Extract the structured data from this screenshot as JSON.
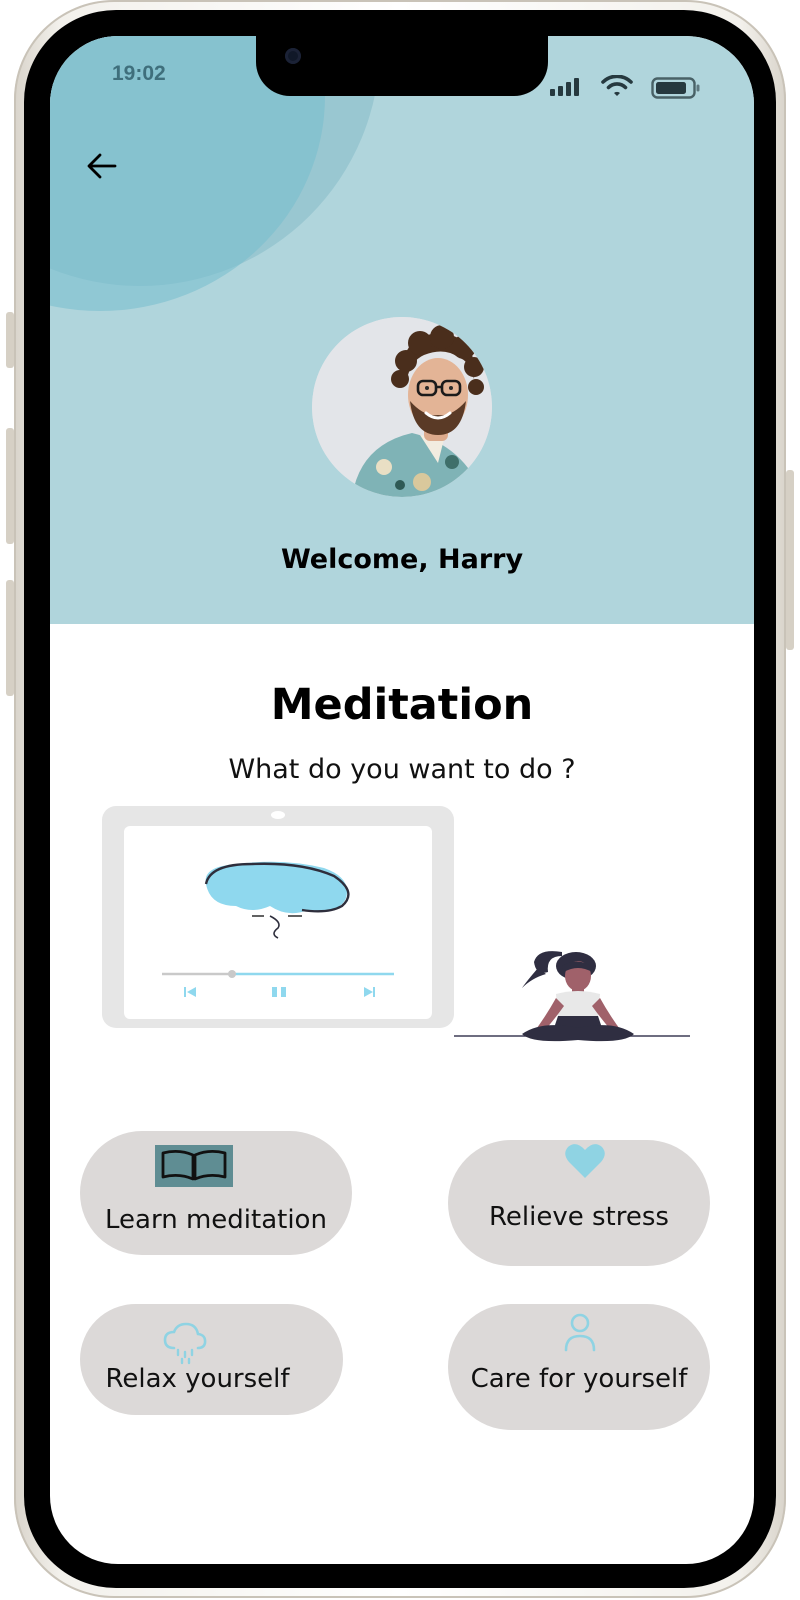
{
  "status_bar": {
    "time": "19:02",
    "icons": [
      "cellular-signal-icon",
      "wifi-icon",
      "battery-icon"
    ]
  },
  "header": {
    "back_icon": "arrow-left-icon",
    "welcome": "Welcome, Harry",
    "background_color": "#b0d5dc"
  },
  "main": {
    "title": "Meditation",
    "subtitle": "What  do you want to do ?"
  },
  "actions": [
    {
      "label": "Learn meditation",
      "icon": "book-icon"
    },
    {
      "label": "Relieve stress",
      "icon": "heart-icon"
    },
    {
      "label": "Relax yourself",
      "icon": "cloud-rain-icon"
    },
    {
      "label": "Care for yourself",
      "icon": "user-icon"
    }
  ],
  "colors": {
    "accent": "#8fd3e3",
    "button_bg": "#dcd9d8"
  }
}
